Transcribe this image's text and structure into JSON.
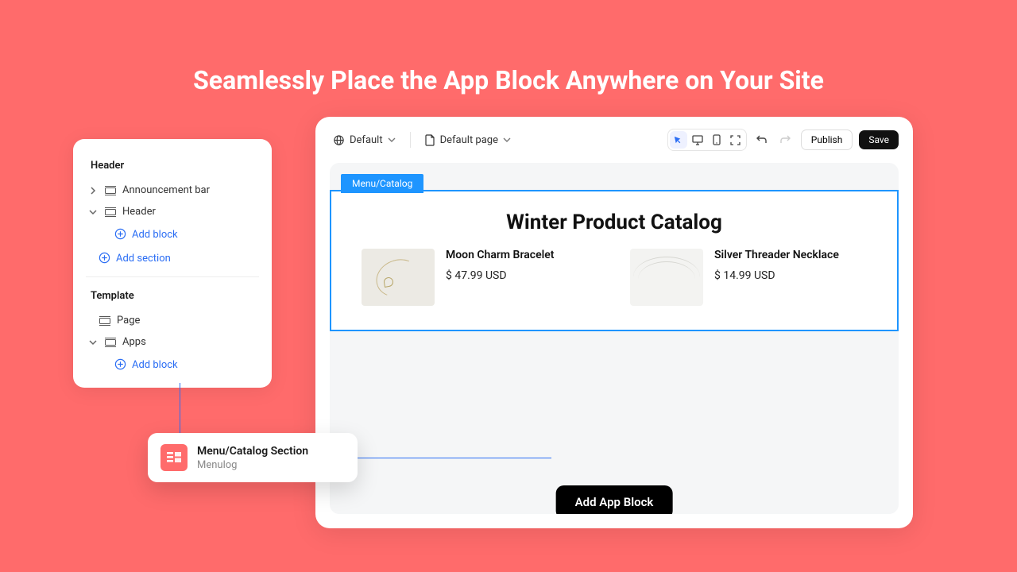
{
  "hero": {
    "title": "Seamlessly Place the App Block Anywhere on Your Site"
  },
  "sidebar": {
    "header_label": "Header",
    "items": {
      "announcement": "Announcement bar",
      "header": "Header"
    },
    "add_block": "Add block",
    "add_section": "Add section",
    "template_label": "Template",
    "page": "Page",
    "apps": "Apps",
    "add_block2": "Add block"
  },
  "popover": {
    "title": "Menu/Catalog Section",
    "subtitle": "Menulog"
  },
  "topbar": {
    "theme": "Default",
    "page": "Default page",
    "publish": "Publish",
    "save": "Save"
  },
  "selection": {
    "tab": "Menu/Catalog",
    "catalog_title": "Winter Product Catalog",
    "products": [
      {
        "name": "Moon Charm Bracelet",
        "price": "$ 47.99 USD"
      },
      {
        "name": "Silver Threader Necklace",
        "price": "$ 14.99 USD"
      }
    ]
  },
  "add_block_btn": "Add App Block"
}
